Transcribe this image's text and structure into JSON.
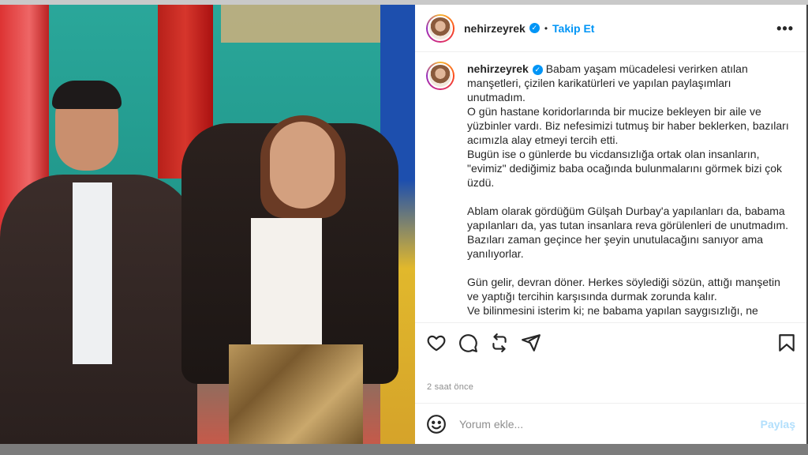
{
  "post": {
    "username": "nehirzeyrek",
    "dot": "•",
    "follow_label": "Takip Et",
    "more_label": "•••",
    "caption_lines": [
      "Babam yaşam mücadelesi verirken atılan",
      "manşetleri, çizilen karikatürleri ve yapılan paylaşımları",
      "unutmadım.",
      "O gün hastane koridorlarında bir mucize bekleyen bir aile ve",
      "yüzbinler vardı. Biz nefesimizi tutmuş bir haber beklerken, bazıları",
      "acımızla alay etmeyi tercih etti.",
      "Bugün ise o günlerde bu vicdansızlığa ortak olan insanların,",
      "\"evimiz\" dediğimiz baba ocağında bulunmalarını görmek bizi çok",
      "üzdü.",
      "",
      "Ablam olarak gördüğüm Gülşah Durbay'a yapılanları da, babama",
      "yapılanları da, yas tutan insanlara reva görülenleri de unutmadım.",
      "Bazıları zaman geçince her şeyin unutulacağını sanıyor ama",
      "yanılıyorlar.",
      "",
      "Gün gelir, devran döner. Herkes söylediği sözün, attığı manşetin",
      "ve yaptığı tercihin karşısında durmak zorunda kalır.",
      "Ve bilinmesini isterim ki; ne babama yapılan saygısızlığı, ne"
    ],
    "time_ago": "2 saat önce",
    "comment_placeholder": "Yorum ekle...",
    "share_label": "Paylaş"
  },
  "icons": {
    "verified": "verified-badge-icon",
    "like": "heart-icon",
    "comment": "comment-icon",
    "repost": "repost-icon",
    "share": "send-icon",
    "save": "bookmark-icon",
    "emoji": "emoji-icon",
    "more": "more-options-icon"
  },
  "colors": {
    "accent": "#0095f6",
    "share_disabled": "#b2dffc",
    "muted": "#8e8e8e"
  }
}
